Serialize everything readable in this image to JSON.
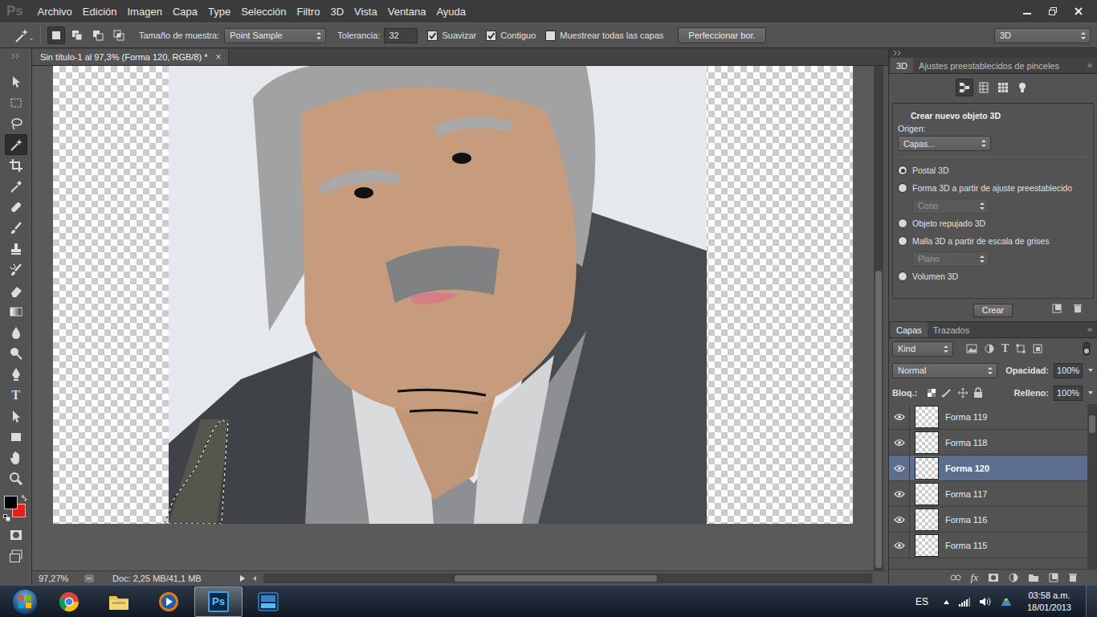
{
  "window": {
    "app_logo": "Ps"
  },
  "menu": [
    "Archivo",
    "Edición",
    "Imagen",
    "Capa",
    "Type",
    "Selección",
    "Filtro",
    "3D",
    "Vista",
    "Ventana",
    "Ayuda"
  ],
  "options_bar": {
    "selection_modes": [
      {
        "selected": true
      },
      {
        "selected": false
      },
      {
        "selected": false
      },
      {
        "selected": false
      }
    ],
    "sample_size_label": "Tamaño de muestra:",
    "sample_size": "Point Sample",
    "tolerance_label": "Tolerancia:",
    "tolerance": "32",
    "checkboxes": [
      {
        "label": "Suavizar",
        "checked": true
      },
      {
        "label": "Contiguo",
        "checked": true
      },
      {
        "label": "Muestrear todas las capas",
        "checked": false
      }
    ],
    "refine_button": "Perfeccionar bor.",
    "workspace": "3D"
  },
  "tools": [
    {
      "selected": false
    },
    {
      "selected": false
    },
    {
      "selected": false
    },
    {
      "selected": true
    },
    {
      "selected": false
    },
    {
      "selected": false
    },
    {
      "selected": false
    },
    {
      "selected": false
    },
    {
      "selected": false
    },
    {
      "selected": false
    },
    {
      "selected": false
    },
    {
      "selected": false
    },
    {
      "selected": false
    },
    {
      "selected": false
    },
    {
      "selected": false
    },
    {
      "glyph": "T",
      "selected": false
    },
    {
      "selected": false
    },
    {
      "selected": false
    },
    {
      "selected": false
    },
    {
      "selected": false
    },
    {
      "selected": false
    },
    {
      "selected": false
    }
  ],
  "colors": {
    "foreground": "#000000",
    "background": "#e8201c"
  },
  "document": {
    "tab": "Sin título-1 al 97,3% (Forma 120, RGB/8) *",
    "close": "×"
  },
  "status_bar": {
    "zoom": "97,27%",
    "doc_size": "Doc: 2,25 MB/41,1 MB"
  },
  "panel_3d": {
    "tabs": [
      {
        "label": "3D",
        "selected": true
      },
      {
        "label": "Ajustes preestablecidos de pinceles",
        "selected": false
      }
    ],
    "view_buttons": [
      {
        "selected": true
      },
      {
        "selected": false
      },
      {
        "selected": false
      },
      {
        "selected": false
      }
    ],
    "heading": "Crear nuevo objeto 3D",
    "origin_label": "Origen:",
    "origin": "Capas...",
    "options": [
      {
        "kind": "radio",
        "label": "Postal 3D",
        "selected": true
      },
      {
        "kind": "radio",
        "label": "Forma 3D a partir de ajuste preestablecido",
        "selected": false
      },
      {
        "kind": "dropdown",
        "label": "Cono",
        "disabled": true
      },
      {
        "kind": "radio",
        "label": "Objeto repujado 3D",
        "selected": false
      },
      {
        "kind": "radio",
        "label": "Malla 3D a partir de escala de grises",
        "selected": false
      },
      {
        "kind": "dropdown",
        "label": "Plano",
        "disabled": true
      },
      {
        "kind": "radio",
        "label": "Volumen 3D",
        "selected": false
      }
    ],
    "create_button": "Crear"
  },
  "layers_panel": {
    "tabs": [
      {
        "label": "Capas",
        "selected": true
      },
      {
        "label": "Trazados",
        "selected": false
      }
    ],
    "filter_kind": "Kind",
    "filter_type_glyph": "T",
    "blend_mode": "Normal",
    "opacity_label": "Opacidad:",
    "opacity": "100%",
    "lock_label": "Bloq.:",
    "fill_label": "Relleno:",
    "fill": "100%",
    "layers": [
      {
        "name": "Forma 119",
        "visible": true,
        "selected": false
      },
      {
        "name": "Forma 118",
        "visible": true,
        "selected": false
      },
      {
        "name": "Forma 120",
        "visible": true,
        "selected": true
      },
      {
        "name": "Forma 117",
        "visible": true,
        "selected": false
      },
      {
        "name": "Forma 116",
        "visible": true,
        "selected": false
      },
      {
        "name": "Forma 115",
        "visible": true,
        "selected": false
      }
    ],
    "bottom_fx": "fx"
  },
  "taskbar": {
    "apps": [
      {
        "selected": false
      },
      {
        "selected": false
      },
      {
        "selected": false
      },
      {
        "label": "Ps",
        "selected": true
      },
      {
        "selected": false
      }
    ],
    "language": "ES",
    "time": "03:58 a.m.",
    "date": "18/01/2013"
  }
}
